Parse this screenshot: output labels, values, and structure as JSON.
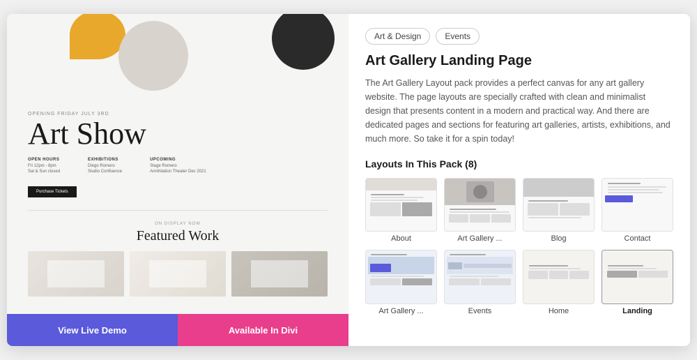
{
  "modal": {
    "left": {
      "preview": {
        "opening_text": "Opening Friday July 3rd",
        "title": "Art Show",
        "open_hours_label": "Open Hours",
        "open_hours_value": "Fri 12pm - 8pm\nSaturday & Sundays closed",
        "exhibitions_label": "Exhibitions",
        "exhibitions_value": "Diego Romero\nStudio Confluence",
        "upcoming_label": "Upcoming",
        "upcoming_value": "Stage Romero\nAnnihilation Theater Dec 2021",
        "buy_button": "Purchase Tickets",
        "on_display": "On Display Now",
        "featured_title": "Featured Work"
      },
      "buttons": {
        "demo": "View Live Demo",
        "divi": "Available In Divi"
      }
    },
    "right": {
      "tags": [
        "Art & Design",
        "Events"
      ],
      "title": "Art Gallery Landing Page",
      "description": "The Art Gallery Layout pack provides a perfect canvas for any art gallery website. The page layouts are specially crafted with clean and minimalist design that presents content in a modern and practical way. And there are dedicated pages and sections for featuring art galleries, artists, exhibitions, and much more. So take it for a spin today!",
      "layouts_heading": "Layouts In This Pack (8)",
      "layouts": [
        {
          "label": "About",
          "bold": false
        },
        {
          "label": "Art Gallery ...",
          "bold": false
        },
        {
          "label": "Blog",
          "bold": false
        },
        {
          "label": "Contact",
          "bold": false
        },
        {
          "label": "Art Gallery ...",
          "bold": false
        },
        {
          "label": "Events",
          "bold": false
        },
        {
          "label": "Home",
          "bold": false
        },
        {
          "label": "Landing",
          "bold": true
        }
      ]
    }
  }
}
